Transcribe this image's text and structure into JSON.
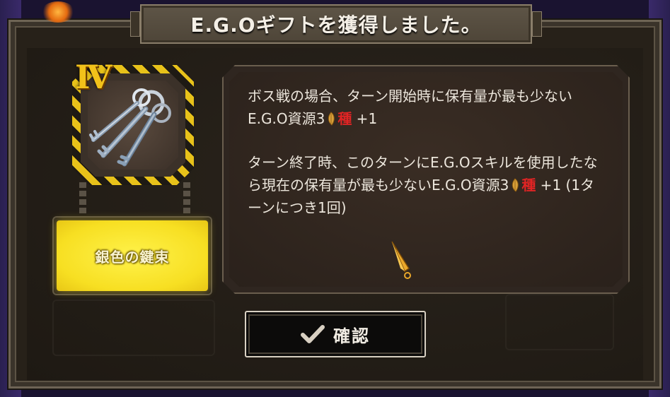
{
  "dialog": {
    "title": "E.G.Oギフトを獲得しました。"
  },
  "gift": {
    "tier": "Ⅳ",
    "name": "銀色の鍵束",
    "icon": "silver-keys-icon"
  },
  "description": {
    "para1_main": "ボス戦の場合、ターン開始時に保有量が最も少ないE.G.O資源3",
    "para1_seed": "種",
    "para1_suffix": " +1",
    "para2_main": "ターン終了時、このターンにE.G.Oスキルを使用したなら現在の保有量が最も少ないE.G.O資源3",
    "para2_seed": "種",
    "para2_suffix": " +1 (1ターンにつき1回)"
  },
  "confirm_button": {
    "label": "確認",
    "icon": "checkmark-icon"
  },
  "colors": {
    "tier_gold": "#f2c21a",
    "name_plate_yellow": "#f7df22",
    "seed_red": "#e02424",
    "panel_bg": "#272119"
  }
}
